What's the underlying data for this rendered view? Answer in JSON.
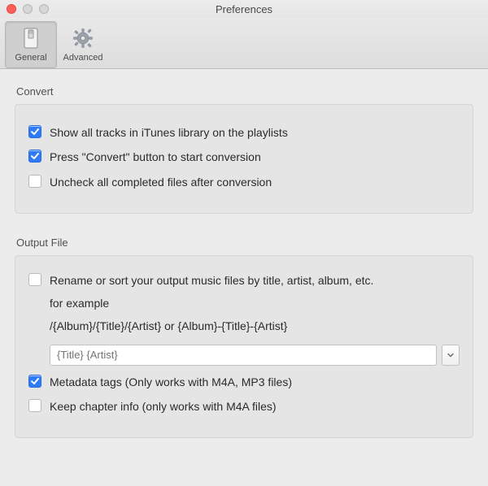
{
  "window": {
    "title": "Preferences"
  },
  "toolbar": {
    "items": [
      {
        "id": "general",
        "label": "General",
        "selected": true
      },
      {
        "id": "advanced",
        "label": "Advanced",
        "selected": false
      }
    ]
  },
  "groups": {
    "convert": {
      "title": "Convert",
      "items": [
        {
          "id": "show_all_tracks",
          "checked": true,
          "label": "Show all tracks in iTunes library on the playlists"
        },
        {
          "id": "press_convert",
          "checked": true,
          "label": "Press \"Convert\" button to start conversion"
        },
        {
          "id": "uncheck_done",
          "checked": false,
          "label": "Uncheck all completed files after conversion"
        }
      ]
    },
    "output": {
      "title": "Output File",
      "rename": {
        "checked": false,
        "label": "Rename or sort your output music files by title, artist, album, etc.",
        "example_intro": "for example",
        "example_pattern": "/{Album}/{Title}/{Artist} or {Album}-{Title}-{Artist}",
        "input_placeholder": "{Title} {Artist}"
      },
      "metadata": {
        "checked": true,
        "label": "Metadata tags (Only works with M4A, MP3 files)"
      },
      "chapter": {
        "checked": false,
        "label": "Keep chapter info (only works with  M4A files)"
      }
    }
  }
}
